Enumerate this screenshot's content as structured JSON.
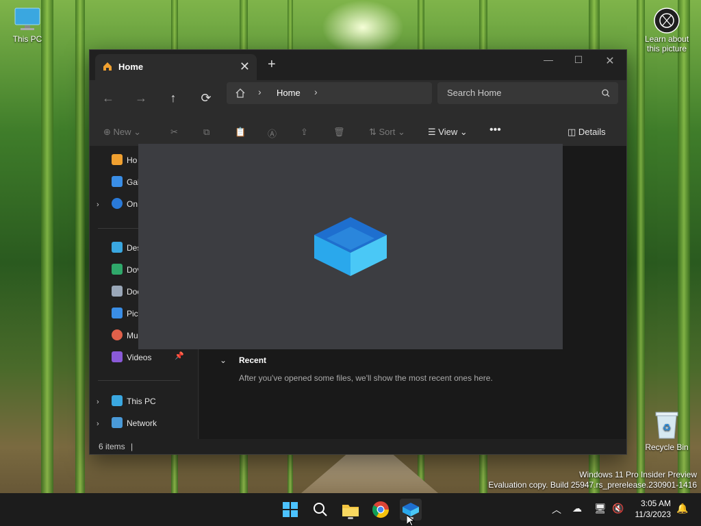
{
  "desktop": {
    "this_pc_label": "This PC",
    "recycle_bin_label": "Recycle Bin",
    "spotlight_label_line1": "Learn about",
    "spotlight_label_line2": "this picture"
  },
  "watermark": {
    "line1": "Windows 11 Pro Insider Preview",
    "line2": "Evaluation copy. Build 25947.rs_prerelease.230901-1416"
  },
  "explorer": {
    "tab_label": "Home",
    "address_crumb": "Home",
    "search_placeholder": "Search Home",
    "commands": {
      "new_label": "New",
      "sort_label": "Sort",
      "view_label": "View",
      "details_label": "Details"
    },
    "sidebar": {
      "items": [
        {
          "label": "Ho"
        },
        {
          "label": "Gal"
        },
        {
          "label": "On"
        },
        {
          "label": "Des"
        },
        {
          "label": "Dov"
        },
        {
          "label": "Doc"
        },
        {
          "label": "Pict"
        },
        {
          "label": "Mu"
        },
        {
          "label": "Videos"
        },
        {
          "label": "This PC"
        },
        {
          "label": "Network"
        }
      ]
    },
    "recent": {
      "title": "Recent",
      "message": "After you've opened some files, we'll show the most recent ones here."
    },
    "status": {
      "items_text": "6 items"
    }
  },
  "taskbar": {
    "time": "3:05 AM",
    "date": "11/3/2023"
  },
  "colors": {
    "accent": "#4cc2ff",
    "window_bg": "#202020",
    "taskbar_bg": "#1c1c1c"
  }
}
